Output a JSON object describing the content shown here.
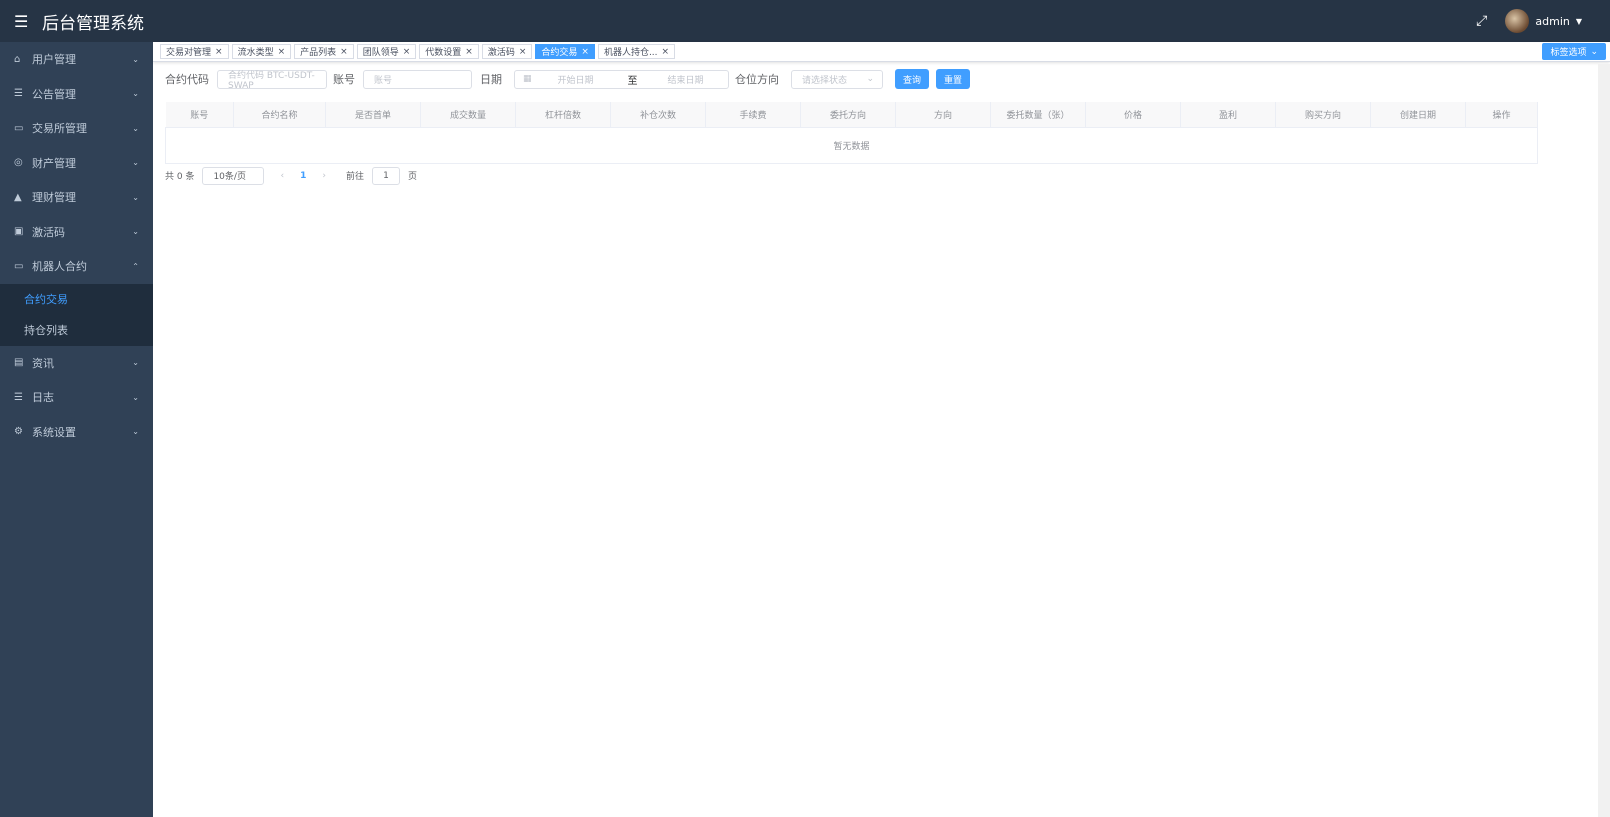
{
  "header": {
    "title": "后台管理系统",
    "user": "admin"
  },
  "sidebar": {
    "items": [
      {
        "label": "用户管理",
        "icon": "home-icon"
      },
      {
        "label": "公告管理",
        "icon": "list-icon"
      },
      {
        "label": "交易所管理",
        "icon": "message-icon"
      },
      {
        "label": "财产管理",
        "icon": "database-icon"
      },
      {
        "label": "理财管理",
        "icon": "bank-icon"
      },
      {
        "label": "激活码",
        "icon": "qrcode-icon"
      },
      {
        "label": "机器人合约",
        "icon": "robot-icon",
        "expanded": true,
        "children": [
          {
            "label": "合约交易",
            "active": true
          },
          {
            "label": "持仓列表"
          }
        ]
      },
      {
        "label": "资讯",
        "icon": "document-icon"
      },
      {
        "label": "日志",
        "icon": "list-icon"
      },
      {
        "label": "系统设置",
        "icon": "gear-icon"
      }
    ]
  },
  "tags": {
    "items": [
      "交易对管理",
      "流水类型",
      "产品列表",
      "团队领导",
      "代数设置",
      "激活码",
      "合约交易",
      "机器人持仓..."
    ],
    "active_index": 6,
    "options_label": "标签选项"
  },
  "form": {
    "code_label": "合约代码",
    "code_placeholder": "合约代码 BTC-USDT-SWAP",
    "account_label": "账号",
    "account_placeholder": "账号",
    "date_label": "日期",
    "date_start_placeholder": "开始日期",
    "date_sep": "至",
    "date_end_placeholder": "结束日期",
    "direction_label": "仓位方向",
    "direction_placeholder": "请选择状态",
    "query_label": "查询",
    "reset_label": "重置"
  },
  "table": {
    "columns": [
      "账号",
      "合约名称",
      "是否首单",
      "成交数量",
      "杠杆倍数",
      "补仓次数",
      "手续费",
      "委托方向",
      "方向",
      "委托数量（张）",
      "价格",
      "盈利",
      "购买方向",
      "创建日期",
      "操作"
    ],
    "empty_text": "暂无数据"
  },
  "pagination": {
    "total_text": "共 0 条",
    "page_size": "10条/页",
    "current_page": "1",
    "goto_label": "前往",
    "goto_value": "1",
    "page_suffix": "页"
  },
  "colors": {
    "accent": "#409eff",
    "sidebar": "#304156",
    "header": "#263445"
  }
}
